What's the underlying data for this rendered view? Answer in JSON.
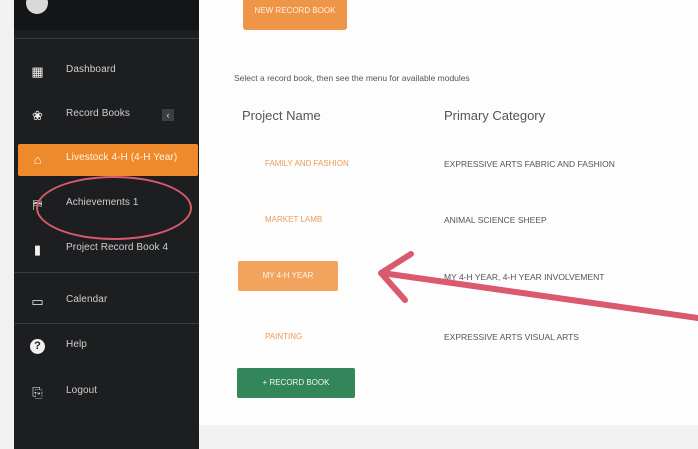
{
  "header": {
    "top_button_label": "NEW RECORD BOOK"
  },
  "sidebar": {
    "items": [
      {
        "label": "Dashboard",
        "icon": "dashboard-icon",
        "glyph": "▦"
      },
      {
        "label": "Record Books",
        "icon": "record-books-icon",
        "glyph": "❀",
        "badge": "‹"
      },
      {
        "label": "Livestock 4-H (4-H Year)",
        "icon": "home-icon",
        "glyph": "⌂",
        "active": true
      },
      {
        "label": "Achievements 1",
        "icon": "achievements-icon",
        "glyph": "⛿"
      },
      {
        "label": "Project Record Book 4",
        "icon": "book-icon",
        "glyph": "▮"
      },
      {
        "label": "Calendar",
        "icon": "calendar-icon",
        "glyph": "▭"
      },
      {
        "label": "Help",
        "icon": "help-icon",
        "glyph": "?"
      },
      {
        "label": "Logout",
        "icon": "logout-icon",
        "glyph": "⎘"
      }
    ]
  },
  "main": {
    "instruction": "Select a record book, then see the menu for available modules",
    "columns": [
      "Project Name",
      "Primary Category"
    ],
    "rows": [
      {
        "name": "FAMILY AND FASHION",
        "category": "EXPRESSIVE ARTS FABRIC AND FASHION"
      },
      {
        "name": "MARKET LAMB",
        "category": "ANIMAL SCIENCE SHEEP"
      },
      {
        "name": "MY 4-H YEAR",
        "category": "MY 4-H YEAR, 4-H YEAR INVOLVEMENT",
        "selected": true
      },
      {
        "name": "PAINTING",
        "category": "EXPRESSIVE ARTS VISUAL ARTS"
      }
    ],
    "record_button_label": "+ RECORD BOOK"
  },
  "colors": {
    "sidebar_bg": "#1d1e20",
    "accent_orange": "#ef8a2c",
    "record_green": "#33865a",
    "annotation_red": "#d85a6c"
  }
}
